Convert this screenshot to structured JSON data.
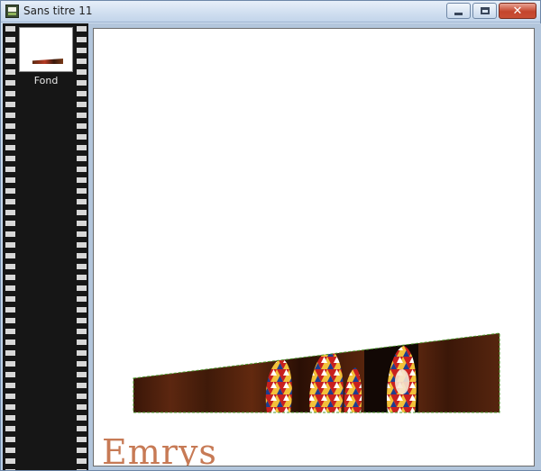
{
  "window": {
    "title": "Sans titre 11",
    "icon": "image-document-icon",
    "controls": [
      "minimize-icon",
      "maximize-icon",
      "close-icon"
    ]
  },
  "layers": {
    "items": [
      {
        "label": "Fond"
      }
    ]
  },
  "canvas": {
    "watermark": "Emrys",
    "watermark_color": "#c77a55",
    "selection_color": "#4a9a2a"
  }
}
